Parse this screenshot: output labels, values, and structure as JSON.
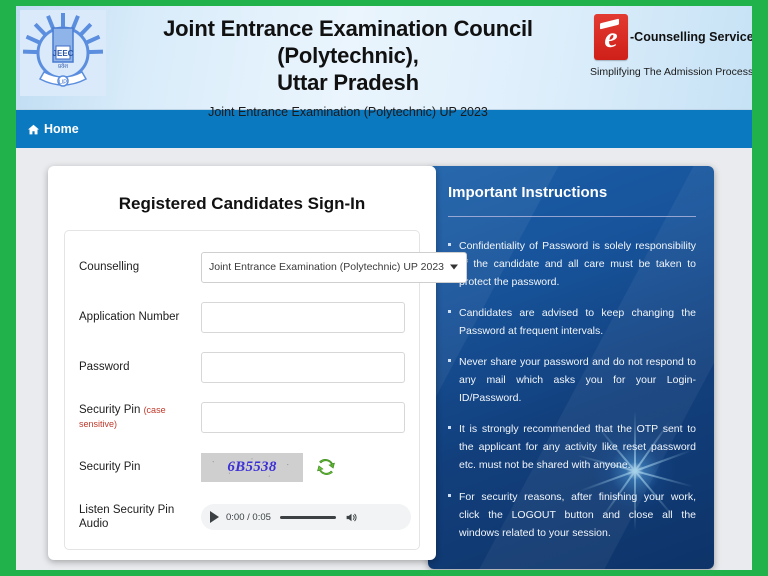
{
  "header": {
    "title_line1": "Joint Entrance Examination Council (Polytechnic),",
    "title_line2": "Uttar Pradesh",
    "subtitle": "Joint Entrance Examination (Polytechnic) UP 2023",
    "left_logo_name": "jeecup-emblem-logo",
    "brand_name": "-Counselling Services",
    "brand_tagline": "Simplifying The Admission Process",
    "brand_mark_letter": "e"
  },
  "navbar": {
    "items": [
      {
        "label": "Home",
        "icon": "home-icon"
      }
    ]
  },
  "signin": {
    "title": "Registered Candidates Sign-In",
    "fields": {
      "counselling": {
        "label": "Counselling",
        "selected": "Joint Entrance Examination (Polytechnic) UP 2023",
        "options": [
          "Joint Entrance Examination (Polytechnic) UP 2023"
        ]
      },
      "application_number": {
        "label": "Application Number",
        "value": "",
        "placeholder": ""
      },
      "password": {
        "label": "Password",
        "value": "",
        "placeholder": ""
      },
      "security_pin_input": {
        "label": "Security Pin",
        "note": "(case sensitive)",
        "value": "",
        "placeholder": ""
      },
      "security_pin_captcha": {
        "label": "Security Pin",
        "captcha_text": "6B5538",
        "refresh_icon": "refresh-captcha-icon"
      },
      "audio": {
        "label": "Listen Security Pin Audio",
        "current_time": "0:00",
        "duration": "0:05",
        "time_display": "0:00 / 0:05",
        "play_icon": "play-icon",
        "volume_icon": "volume-icon"
      }
    }
  },
  "instructions": {
    "title": "Important Instructions",
    "items": [
      "Confidentiality of Password is solely responsibility of the candidate and all care must be taken to protect the password.",
      "Candidates are advised to keep changing the Password at frequent intervals.",
      "Never share your password and do not respond to any mail which asks you for your Login-ID/Password.",
      "It is strongly recommended that the OTP sent to the applicant for any activity like reset password etc. must not be shared with anyone.",
      "For security reasons, after finishing your work, click the LOGOUT button and close all the windows related to your session."
    ]
  },
  "colors": {
    "page_border_green": "#22b24c",
    "navbar_blue": "#0b79c0",
    "header_gradient_light": "#daecf9",
    "instructions_blue_dark": "#0e3469",
    "instructions_blue_light": "#1b5fa8",
    "brand_red": "#cf1f19",
    "captcha_text_blue": "#3b2fd6",
    "note_red": "#c0392b",
    "body_background": "#e9ebee"
  }
}
